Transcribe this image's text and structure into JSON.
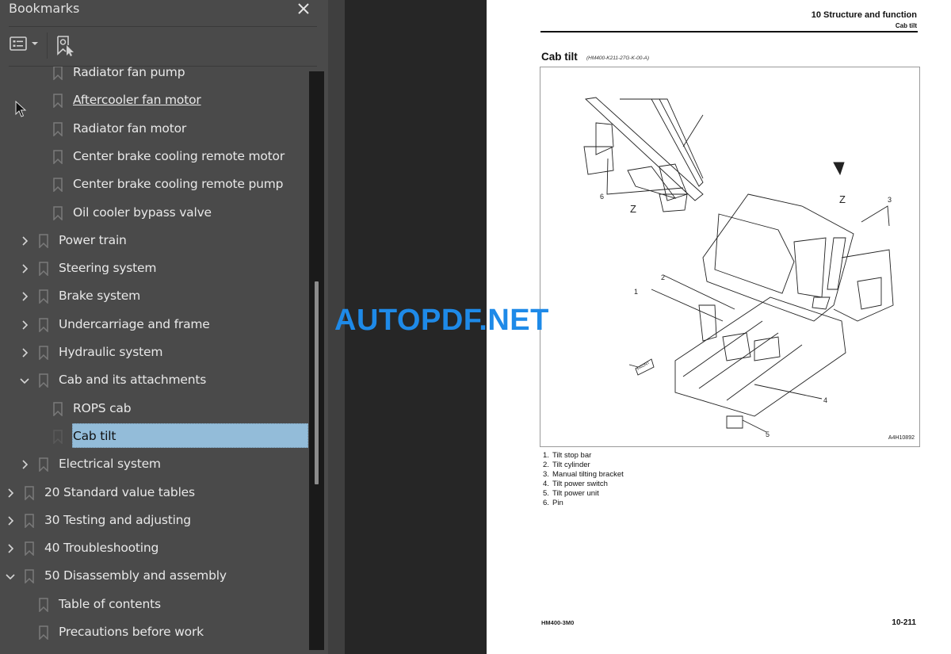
{
  "bookmarks_panel": {
    "title": "Bookmarks",
    "close_icon": "close-icon",
    "toolbar": {
      "options_icon": "list-options-icon",
      "dropdown_icon": "caret-down-icon",
      "find_bookmark_icon": "find-current-bookmark-icon"
    },
    "items": [
      {
        "label": "Radiator fan pump",
        "level": 2,
        "expander": "none"
      },
      {
        "label": "Aftercooler fan motor ",
        "level": 2,
        "expander": "none",
        "hovered": true
      },
      {
        "label": "Radiator fan motor",
        "level": 2,
        "expander": "none"
      },
      {
        "label": "Center brake cooling remote motor",
        "level": 2,
        "expander": "none"
      },
      {
        "label": "Center brake cooling remote pump",
        "level": 2,
        "expander": "none"
      },
      {
        "label": "Oil cooler bypass valve",
        "level": 2,
        "expander": "none"
      },
      {
        "label": "Power train",
        "level": 1,
        "expander": "collapsed"
      },
      {
        "label": "Steering system",
        "level": 1,
        "expander": "collapsed"
      },
      {
        "label": "Brake system",
        "level": 1,
        "expander": "collapsed"
      },
      {
        "label": "Undercarriage and frame",
        "level": 1,
        "expander": "collapsed"
      },
      {
        "label": "Hydraulic system",
        "level": 1,
        "expander": "collapsed"
      },
      {
        "label": "Cab and its attachments",
        "level": 1,
        "expander": "expanded"
      },
      {
        "label": "ROPS cab",
        "level": 2,
        "expander": "none"
      },
      {
        "label": "Cab tilt",
        "level": 2,
        "expander": "none",
        "selected": true
      },
      {
        "label": "Electrical system",
        "level": 1,
        "expander": "collapsed"
      },
      {
        "label": "20 Standard value tables",
        "level": 0,
        "expander": "collapsed"
      },
      {
        "label": "30 Testing and adjusting",
        "level": 0,
        "expander": "collapsed"
      },
      {
        "label": "40 Troubleshooting",
        "level": 0,
        "expander": "collapsed"
      },
      {
        "label": "50 Disassembly and assembly",
        "level": 0,
        "expander": "expanded"
      },
      {
        "label": "Table of contents",
        "level": 1,
        "expander": "none"
      },
      {
        "label": "Precautions before work",
        "level": 1,
        "expander": "none"
      }
    ],
    "colors": {
      "panel_bg": "#4a4a4a",
      "selection_bg": "#93bcd9",
      "text": "#e8e8e8"
    }
  },
  "document_page": {
    "header_section": "10 Structure and function",
    "header_subsection": "Cab tilt",
    "title": "Cab tilt",
    "doc_code": "(HM400-K211-27G-K-00-A)",
    "figure_id": "A4H10892",
    "figure_callouts": {
      "z_label": "Z",
      "front_label": "FRONT",
      "numbers": [
        "1",
        "2",
        "3",
        "4",
        "5",
        "6"
      ]
    },
    "legend": [
      {
        "num": "1.",
        "text": "Tilt stop bar"
      },
      {
        "num": "2.",
        "text": "Tilt cylinder"
      },
      {
        "num": "3.",
        "text": "Manual tilting bracket"
      },
      {
        "num": "4.",
        "text": "Tilt power switch"
      },
      {
        "num": "5.",
        "text": "Tilt power unit"
      },
      {
        "num": "6.",
        "text": "Pin"
      }
    ],
    "footer_model": "HM400-3M0",
    "footer_page": "10-211"
  },
  "watermark": {
    "text": "AUTOPDF.NET",
    "color": "#1e8ae8"
  }
}
